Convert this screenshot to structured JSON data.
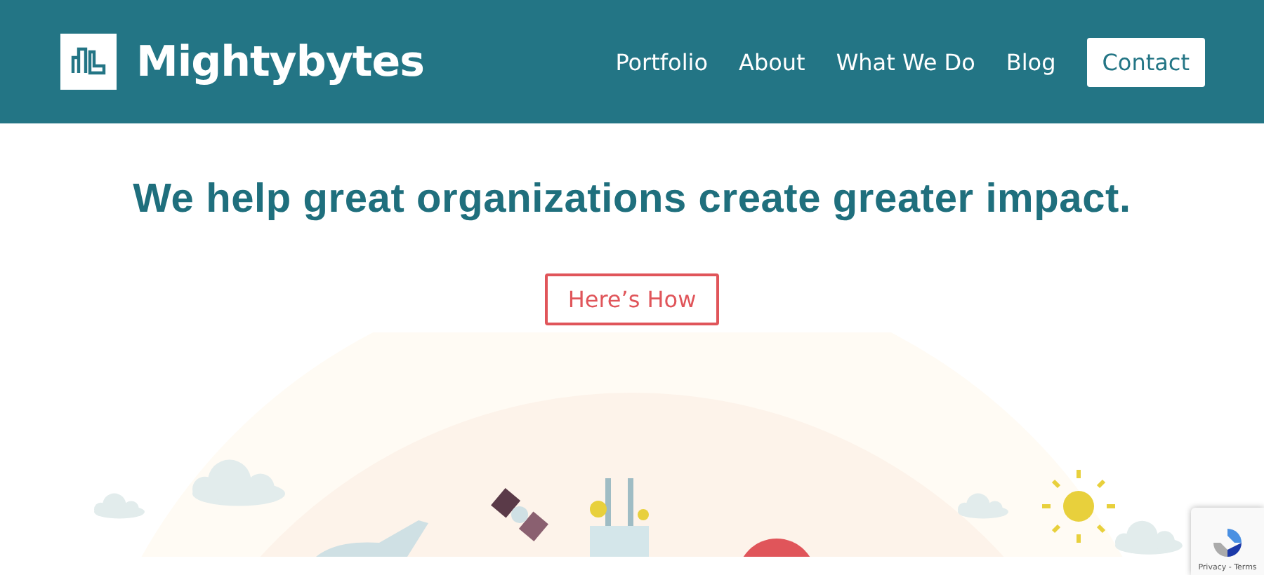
{
  "header": {
    "logo_text": "Mightybytes",
    "nav": [
      {
        "label": "Portfolio",
        "kind": "link"
      },
      {
        "label": "About",
        "kind": "link"
      },
      {
        "label": "What We Do",
        "kind": "link"
      },
      {
        "label": "Blog",
        "kind": "link"
      },
      {
        "label": "Contact",
        "kind": "button"
      }
    ]
  },
  "hero": {
    "headline": "We help great organizations create greater impact.",
    "cta": "Here’s How"
  },
  "recaptcha": {
    "links": "Privacy - Terms"
  }
}
